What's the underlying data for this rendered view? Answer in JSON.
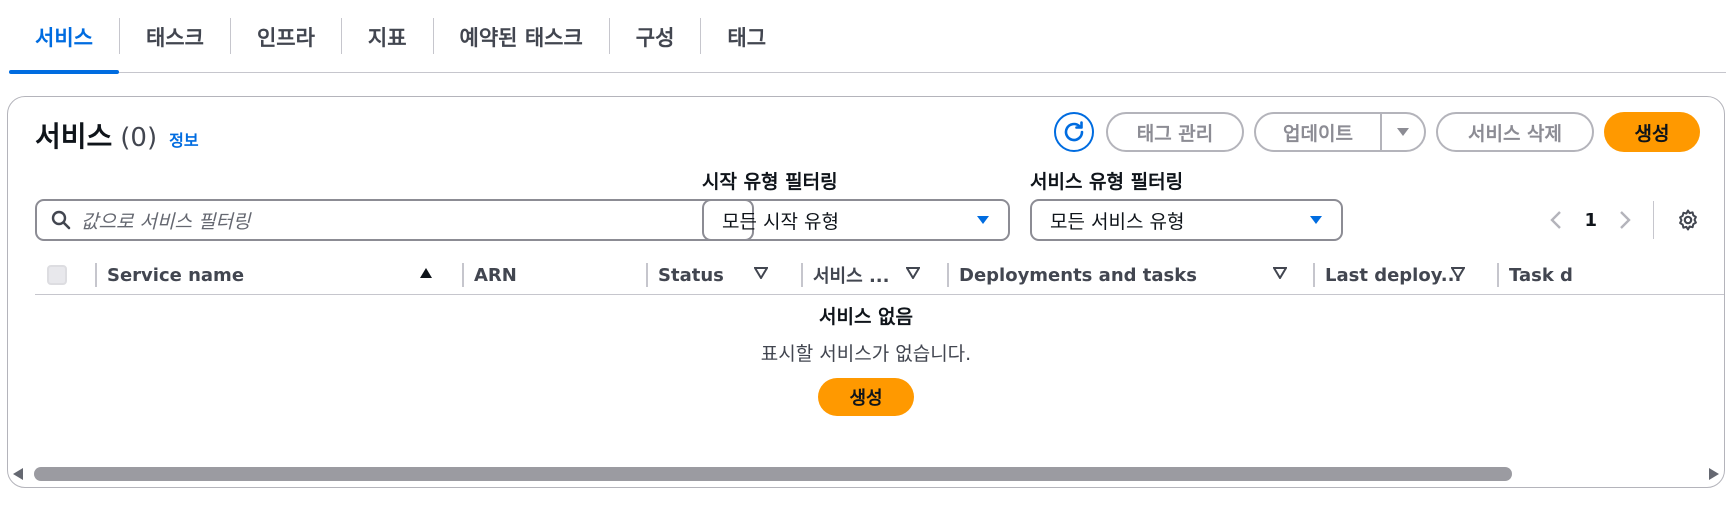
{
  "tabs": [
    {
      "label": "서비스",
      "active": true
    },
    {
      "label": "태스크"
    },
    {
      "label": "인프라"
    },
    {
      "label": "지표"
    },
    {
      "label": "예약된 태스크"
    },
    {
      "label": "구성"
    },
    {
      "label": "태그"
    }
  ],
  "panel": {
    "title": "서비스",
    "count": "(0)",
    "info": "정보"
  },
  "actions": {
    "manage_tags": "태그 관리",
    "update": "업데이트",
    "delete_service": "서비스 삭제",
    "create": "생성"
  },
  "filters": {
    "search_placeholder": "값으로 서비스 필터링",
    "launch_type_label": "시작 유형 필터링",
    "launch_type_value": "모든 시작 유형",
    "service_type_label": "서비스 유형 필터링",
    "service_type_value": "모든 서비스 유형"
  },
  "pagination": {
    "page": "1"
  },
  "table": {
    "columns": [
      "Service name",
      "ARN",
      "Status",
      "서비스 ...",
      "Deployments and tasks",
      "Last deploy...",
      "Task d"
    ]
  },
  "empty_state": {
    "title": "서비스 없음",
    "description": "표시할 서비스가 없습니다.",
    "button": "생성"
  },
  "colors": {
    "accent": "#006ce0",
    "primary_button": "#ff9900",
    "disabled": "#8c8c94"
  }
}
